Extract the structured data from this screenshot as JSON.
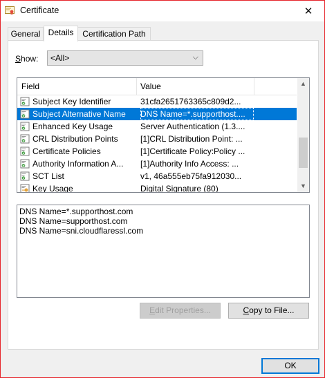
{
  "window": {
    "title": "Certificate",
    "accent_color": "#e6232a",
    "close_icon": "close-icon"
  },
  "tabs": [
    {
      "label": "General",
      "active": false
    },
    {
      "label": "Details",
      "active": true
    },
    {
      "label": "Certification Path",
      "active": false
    }
  ],
  "show": {
    "label": "Show:",
    "selected": "<All>"
  },
  "list": {
    "headers": {
      "field": "Field",
      "value": "Value"
    },
    "rows": [
      {
        "field": "Subject Key Identifier",
        "value": "31cfa2651763365c809d2...",
        "icon": "cert-field-icon",
        "selected": false
      },
      {
        "field": "Subject Alternative Name",
        "value": "DNS Name=*.supporthost....",
        "icon": "cert-field-icon",
        "selected": true
      },
      {
        "field": "Enhanced Key Usage",
        "value": "Server Authentication (1.3....",
        "icon": "cert-field-icon",
        "selected": false
      },
      {
        "field": "CRL Distribution Points",
        "value": "[1]CRL Distribution Point: ...",
        "icon": "cert-field-icon",
        "selected": false
      },
      {
        "field": "Certificate Policies",
        "value": "[1]Certificate Policy:Policy ...",
        "icon": "cert-field-icon",
        "selected": false
      },
      {
        "field": "Authority Information A...",
        "value": "[1]Authority Info Access: ...",
        "icon": "cert-field-icon",
        "selected": false
      },
      {
        "field": "SCT List",
        "value": "v1, 46a555eb75fa912030...",
        "icon": "cert-field-icon",
        "selected": false
      },
      {
        "field": "Key Usage",
        "value": "Digital Signature (80)",
        "icon": "key-usage-icon",
        "selected": false
      }
    ],
    "selection_color": "#0078d7"
  },
  "detail": {
    "lines": [
      "DNS Name=*.supporthost.com",
      "DNS Name=supporthost.com",
      "DNS Name=sni.cloudflaressl.com"
    ]
  },
  "buttons": {
    "edit_properties": "Edit Properties...",
    "copy_to_file": "Copy to File...",
    "ok": "OK"
  }
}
